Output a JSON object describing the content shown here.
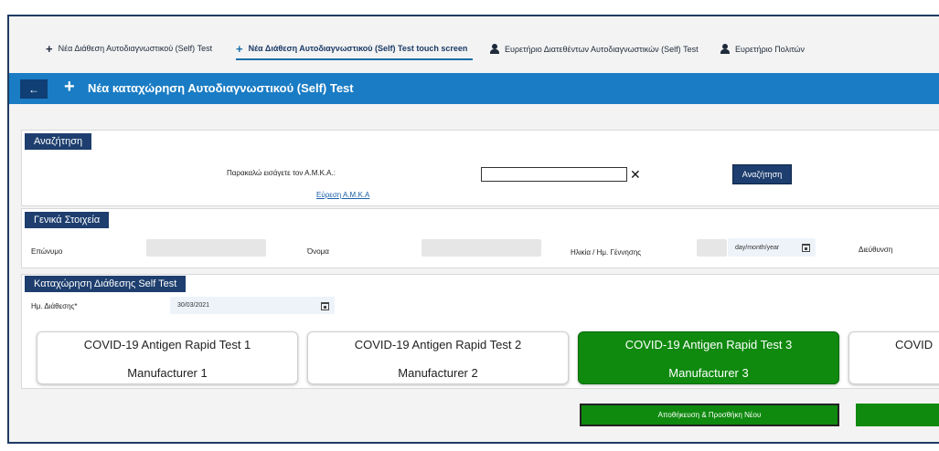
{
  "nav": {
    "tabs": [
      {
        "label": "Νέα Διάθεση Αυτοδιαγνωστικού (Self) Test",
        "icon": "plus-icon"
      },
      {
        "label": "Νέα Διάθεση Αυτοδιαγνωστικού (Self) Test touch screen",
        "icon": "plus-icon",
        "active": true
      },
      {
        "label": "Ευρετήριο Διατεθέντων Αυτοδιαγνωστικών (Self) Test",
        "icon": "person-icon"
      },
      {
        "label": "Ευρετήριο Πολιτών",
        "icon": "person-icon"
      }
    ],
    "plus_glyph": "+",
    "active_color": "#1a6ea8"
  },
  "header": {
    "back_glyph": "←",
    "plus_glyph": "+",
    "title": "Νέα καταχώρηση Αυτοδιαγνωστικού (Self) Test",
    "bar_color": "#1a7cc4"
  },
  "search": {
    "section_label": "Αναζήτηση",
    "prompt": "Παρακαλώ εισάγετε τον Α.Μ.Κ.Α.:",
    "amka_value": "",
    "clear_glyph": "✕",
    "button_label": "Αναζήτηση",
    "find_link": "Εύρεση Α.Μ.Κ.Α"
  },
  "general": {
    "section_label": "Γενικά Στοιχεία",
    "surname_label": "Επώνυμο",
    "surname_value": "",
    "name_label": "Όνομα",
    "name_value": "",
    "age_label": "Ηλικία / Ημ. Γέννησης",
    "age_value": "",
    "dob_placeholder": "day/month/year",
    "address_label": "Διεύθυνση"
  },
  "disposal": {
    "section_label": "Καταχώρηση Διάθεσης Self Test",
    "date_label": "Ημ. Διάθεσης*",
    "date_value": "30/03/2021",
    "tests": [
      {
        "name": "COVID-19 Antigen Rapid Test 1",
        "manufacturer": "Manufacturer 1",
        "selected": false
      },
      {
        "name": "COVID-19 Antigen Rapid Test 2",
        "manufacturer": "Manufacturer 2",
        "selected": false
      },
      {
        "name": "COVID-19 Antigen Rapid Test 3",
        "manufacturer": "Manufacturer 3",
        "selected": true
      },
      {
        "name": "COVID",
        "manufacturer": "",
        "selected": false
      }
    ],
    "selected_color": "#0f8a0f",
    "save_add_label": "Αποθήκευση & Προσθήκη Νέου",
    "save_label": ""
  }
}
